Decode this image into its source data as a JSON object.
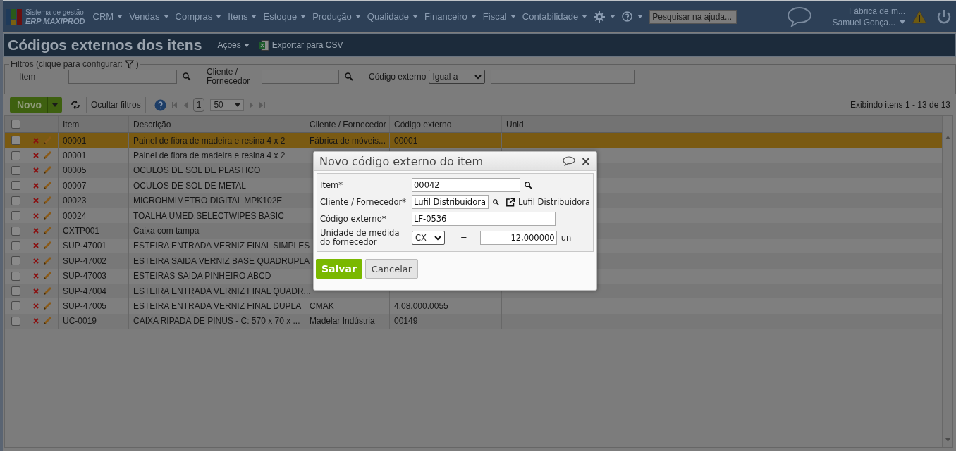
{
  "top_bar": {
    "logo_line1": "Sistema de gestão",
    "logo_line2": "ERP MAXIPROD",
    "menus": [
      {
        "label": "CRM"
      },
      {
        "label": "Vendas"
      },
      {
        "label": "Compras"
      },
      {
        "label": "Itens"
      },
      {
        "label": "Estoque"
      },
      {
        "label": "Produção"
      },
      {
        "label": "Qualidade"
      },
      {
        "label": "Financeiro"
      },
      {
        "label": "Fiscal"
      },
      {
        "label": "Contabilidade"
      }
    ],
    "search_placeholder": "Pesquisar na ajuda...",
    "company": "Fábrica de m...",
    "user": "Samuel Gonça..."
  },
  "page": {
    "title": "Códigos externos dos itens",
    "actions": "Ações",
    "export": "Exportar para CSV"
  },
  "filters": {
    "legend": "Filtros (clique para configurar:",
    "legend_end": ")",
    "item_label": "Item",
    "client_label": "Cliente / Fornecedor",
    "code_label": "Código externo",
    "code_operator": "Igual a"
  },
  "toolbar": {
    "new": "Novo",
    "hide_filters": "Ocultar filtros",
    "page": "1",
    "page_size": "50",
    "status": "Exibindo itens 1 - 13 de 13"
  },
  "table": {
    "header_checked": false,
    "columns": [
      "Item",
      "Descrição",
      "Cliente / Fornecedor",
      "Código externo",
      "Unid"
    ],
    "rows": [
      {
        "item": "00001",
        "description": "Painel de fibra de madeira e resina 4 x 2",
        "client": "Fábrica de móveis...",
        "code": "00001",
        "selected": true,
        "checked": false
      },
      {
        "item": "00001",
        "description": "Painel de fibra de madeira e resina 4 x 2",
        "selected": false,
        "checked": false
      },
      {
        "item": "00005",
        "description": "OCULOS DE SOL DE PLASTICO",
        "selected": false,
        "checked": false
      },
      {
        "item": "00007",
        "description": "OCULOS DE SOL DE METAL",
        "selected": false,
        "checked": false
      },
      {
        "item": "00023",
        "description": "MICROHMIMETRO DIGITAL MPK102E",
        "selected": false,
        "checked": false
      },
      {
        "item": "00024",
        "description": "TOALHA UMED.SELECTWIPES BASIC",
        "selected": false,
        "checked": false
      },
      {
        "item": "CXTP001",
        "description": "Caixa com tampa",
        "selected": false,
        "checked": false
      },
      {
        "item": "SUP-47001",
        "description": "ESTEIRA ENTRADA VERNIZ FINAL SIMPLES",
        "selected": false,
        "checked": false
      },
      {
        "item": "SUP-47002",
        "description": "ESTEIRA SAIDA VERNIZ BASE QUADRUPLA",
        "selected": false,
        "checked": false
      },
      {
        "item": "SUP-47003",
        "description": "ESTEIRAS SAIDA PINHEIRO ABCD",
        "selected": false,
        "checked": false
      },
      {
        "item": "SUP-47004",
        "description": "ESTEIRA ENTRADA VERNIZ FINAL QUADR...",
        "selected": false,
        "checked": false
      },
      {
        "item": "SUP-47005",
        "description": "ESTEIRA ENTRADA VERNIZ FINAL DUPLA",
        "client": "CMAK",
        "code": "4.08.000.0055",
        "selected": false,
        "checked": false
      },
      {
        "item": "UC-0019",
        "description": "CAIXA RIPADA DE PINUS - C: 570 x 70 x ...",
        "client": "Madelar Indústria",
        "code": "00149",
        "selected": false,
        "checked": false
      }
    ]
  },
  "dialog": {
    "title": "Novo código externo do item",
    "close": "×",
    "item_label": "Item*",
    "item_value": "00042",
    "client_label": "Cliente / Fornecedor*",
    "client_value": "Lufil Distribuidora",
    "client_link": "Lufil Distribuidora",
    "code_label": "Código externo*",
    "code_value": "LF-0536",
    "unit_label": "Unidade de medida do fornecedor",
    "unit_value": "CX",
    "equals": "=",
    "factor": "12,000000",
    "unit_suffix": "un",
    "save": "Salvar",
    "cancel": "Cancelar"
  }
}
